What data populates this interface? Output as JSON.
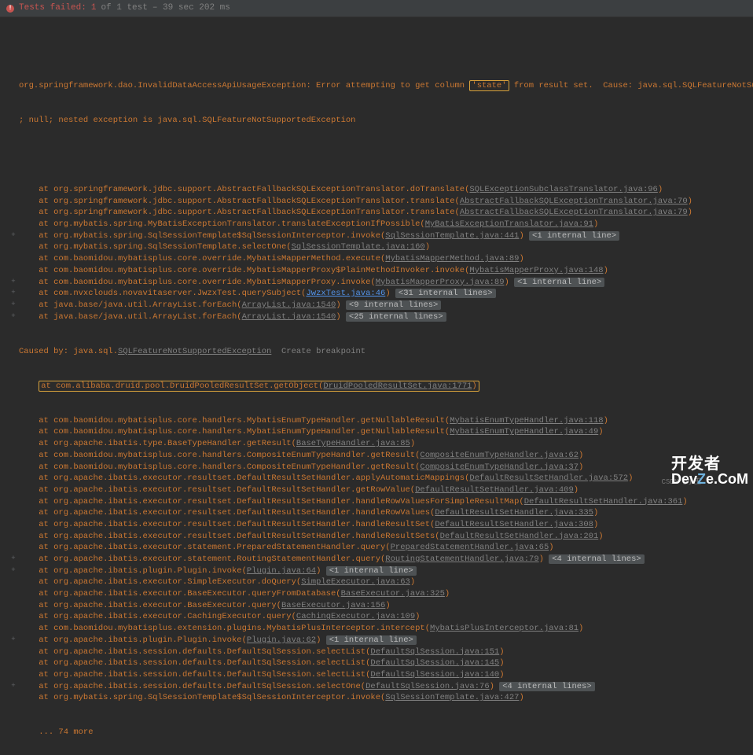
{
  "header": {
    "status": "Tests failed:",
    "count": "1",
    "of": "of 1 test",
    "time": "– 39 sec 202 ms"
  },
  "exception": {
    "line1_a": "org.springframework.dao.InvalidDataAccessApiUsageException: Error attempting to get column ",
    "line1_hl": "'state'",
    "line1_b": " from result set.  Cause: java.sql.SQLFeatureNotSupportedException",
    "line2": "; null; nested exception is java.sql.SQLFeatureNotSupportedException"
  },
  "stack": [
    {
      "at": "at ",
      "pkg": "org.springframework.jdbc.support.AbstractFallbackSQLExceptionTranslator.doTranslate(",
      "link": "SQLExceptionSubclassTranslator.java:96",
      "close": ")"
    },
    {
      "at": "at ",
      "pkg": "org.springframework.jdbc.support.AbstractFallbackSQLExceptionTranslator.translate(",
      "link": "AbstractFallbackSQLExceptionTranslator.java:70",
      "close": ")"
    },
    {
      "at": "at ",
      "pkg": "org.springframework.jdbc.support.AbstractFallbackSQLExceptionTranslator.translate(",
      "link": "AbstractFallbackSQLExceptionTranslator.java:79",
      "close": ")"
    },
    {
      "at": "at ",
      "pkg": "org.mybatis.spring.MyBatisExceptionTranslator.translateExceptionIfPossible(",
      "link": "MyBatisExceptionTranslator.java:91",
      "close": ")"
    },
    {
      "at": "at ",
      "pkg": "org.mybatis.spring.SqlSessionTemplate$SqlSessionInterceptor.invoke(",
      "link": "SqlSessionTemplate.java:441",
      "close": ") ",
      "badge": "<1 internal line>",
      "g": "+"
    },
    {
      "at": "at ",
      "pkg": "org.mybatis.spring.SqlSessionTemplate.selectOne(",
      "link": "SqlSessionTemplate.java:160",
      "close": ")"
    },
    {
      "at": "at ",
      "pkg": "com.baomidou.mybatisplus.core.override.MybatisMapperMethod.execute(",
      "link": "MybatisMapperMethod.java:89",
      "close": ")"
    },
    {
      "at": "at ",
      "pkg": "com.baomidou.mybatisplus.core.override.MybatisMapperProxy$PlainMethodInvoker.invoke(",
      "link": "MybatisMapperProxy.java:148",
      "close": ")"
    },
    {
      "at": "at ",
      "pkg": "com.baomidou.mybatisplus.core.override.MybatisMapperProxy.invoke(",
      "link": "MybatisMapperProxy.java:89",
      "close": ") ",
      "badge": "<1 internal line>",
      "g": "+"
    },
    {
      "at": "at ",
      "pkg": "com.nvxclouds.novavitaserver.JwzxTest.querySubject(",
      "link": "JwzxTest.java:46",
      "close": ") ",
      "badge": "<31 internal lines>",
      "blue": true,
      "g": "+"
    },
    {
      "at": "at ",
      "pkg": "java.base/java.util.ArrayList.forEach(",
      "link": "ArrayList.java:1540",
      "close": ") ",
      "badge": "<9 internal lines>",
      "g": "+"
    },
    {
      "at": "at ",
      "pkg": "java.base/java.util.ArrayList.forEach(",
      "link": "ArrayList.java:1540",
      "close": ") ",
      "badge": "<25 internal lines>",
      "g": "+"
    }
  ],
  "caused": {
    "prefix": "Caused by: ",
    "ex": "java.sql.",
    "exlink": "SQLFeatureNotSupportedException",
    "bp": "  Create breakpoint"
  },
  "hlline": {
    "at": "at ",
    "pkg": "com.alibaba.druid.pool.DruidPooledResultSet.getObject(",
    "link": "DruidPooledResultSet.java:1771",
    "close": ")"
  },
  "stack2": [
    {
      "at": "at ",
      "pkg": "com.baomidou.mybatisplus.core.handlers.MybatisEnumTypeHandler.getNullableResult(",
      "link": "MybatisEnumTypeHandler.java:118",
      "close": ")"
    },
    {
      "at": "at ",
      "pkg": "com.baomidou.mybatisplus.core.handlers.MybatisEnumTypeHandler.getNullableResult(",
      "link": "MybatisEnumTypeHandler.java:49",
      "close": ")"
    },
    {
      "at": "at ",
      "pkg": "org.apache.ibatis.type.BaseTypeHandler.getResult(",
      "link": "BaseTypeHandler.java:85",
      "close": ")"
    },
    {
      "at": "at ",
      "pkg": "com.baomidou.mybatisplus.core.handlers.CompositeEnumTypeHandler.getResult(",
      "link": "CompositeEnumTypeHandler.java:62",
      "close": ")"
    },
    {
      "at": "at ",
      "pkg": "com.baomidou.mybatisplus.core.handlers.CompositeEnumTypeHandler.getResult(",
      "link": "CompositeEnumTypeHandler.java:37",
      "close": ")"
    },
    {
      "at": "at ",
      "pkg": "org.apache.ibatis.executor.resultset.DefaultResultSetHandler.applyAutomaticMappings(",
      "link": "DefaultResultSetHandler.java:572",
      "close": ")"
    },
    {
      "at": "at ",
      "pkg": "org.apache.ibatis.executor.resultset.DefaultResultSetHandler.getRowValue(",
      "link": "DefaultResultSetHandler.java:409",
      "close": ")"
    },
    {
      "at": "at ",
      "pkg": "org.apache.ibatis.executor.resultset.DefaultResultSetHandler.handleRowValuesForSimpleResultMap(",
      "link": "DefaultResultSetHandler.java:361",
      "close": ")"
    },
    {
      "at": "at ",
      "pkg": "org.apache.ibatis.executor.resultset.DefaultResultSetHandler.handleRowValues(",
      "link": "DefaultResultSetHandler.java:335",
      "close": ")"
    },
    {
      "at": "at ",
      "pkg": "org.apache.ibatis.executor.resultset.DefaultResultSetHandler.handleResultSet(",
      "link": "DefaultResultSetHandler.java:308",
      "close": ")"
    },
    {
      "at": "at ",
      "pkg": "org.apache.ibatis.executor.resultset.DefaultResultSetHandler.handleResultSets(",
      "link": "DefaultResultSetHandler.java:201",
      "close": ")"
    },
    {
      "at": "at ",
      "pkg": "org.apache.ibatis.executor.statement.PreparedStatementHandler.query(",
      "link": "PreparedStatementHandler.java:65",
      "close": ")"
    },
    {
      "at": "at ",
      "pkg": "org.apache.ibatis.executor.statement.RoutingStatementHandler.query(",
      "link": "RoutingStatementHandler.java:79",
      "close": ") ",
      "badge": "<4 internal lines>",
      "g": "+"
    },
    {
      "at": "at ",
      "pkg": "org.apache.ibatis.plugin.Plugin.invoke(",
      "link": "Plugin.java:64",
      "close": ") ",
      "badge": "<1 internal line>",
      "g": "+"
    },
    {
      "at": "at ",
      "pkg": "org.apache.ibatis.executor.SimpleExecutor.doQuery(",
      "link": "SimpleExecutor.java:63",
      "close": ")"
    },
    {
      "at": "at ",
      "pkg": "org.apache.ibatis.executor.BaseExecutor.queryFromDatabase(",
      "link": "BaseExecutor.java:325",
      "close": ")"
    },
    {
      "at": "at ",
      "pkg": "org.apache.ibatis.executor.BaseExecutor.query(",
      "link": "BaseExecutor.java:156",
      "close": ")"
    },
    {
      "at": "at ",
      "pkg": "org.apache.ibatis.executor.CachingExecutor.query(",
      "link": "CachingExecutor.java:109",
      "close": ")"
    },
    {
      "at": "at ",
      "pkg": "com.baomidou.mybatisplus.extension.plugins.MybatisPlusInterceptor.intercept(",
      "link": "MybatisPlusInterceptor.java:81",
      "close": ")"
    },
    {
      "at": "at ",
      "pkg": "org.apache.ibatis.plugin.Plugin.invoke(",
      "link": "Plugin.java:62",
      "close": ") ",
      "badge": "<1 internal line>",
      "g": "+"
    },
    {
      "at": "at ",
      "pkg": "org.apache.ibatis.session.defaults.DefaultSqlSession.selectList(",
      "link": "DefaultSqlSession.java:151",
      "close": ")"
    },
    {
      "at": "at ",
      "pkg": "org.apache.ibatis.session.defaults.DefaultSqlSession.selectList(",
      "link": "DefaultSqlSession.java:145",
      "close": ")"
    },
    {
      "at": "at ",
      "pkg": "org.apache.ibatis.session.defaults.DefaultSqlSession.selectList(",
      "link": "DefaultSqlSession.java:140",
      "close": ")"
    },
    {
      "at": "at ",
      "pkg": "org.apache.ibatis.session.defaults.DefaultSqlSession.selectOne(",
      "link": "DefaultSqlSession.java:76",
      "close": ") ",
      "badge": "<4 internal lines>",
      "g": "+"
    },
    {
      "at": "at ",
      "pkg": "org.mybatis.spring.SqlSessionTemplate$SqlSessionInterceptor.invoke(",
      "link": "SqlSessionTemplate.java:427",
      "close": ")"
    }
  ],
  "more": "... 74 more",
  "watermark": {
    "l1": "开发者",
    "l2a": "Dev",
    "l2b": "Z",
    "l2c": "e.CoM"
  },
  "csdn": "CSDN @小王"
}
